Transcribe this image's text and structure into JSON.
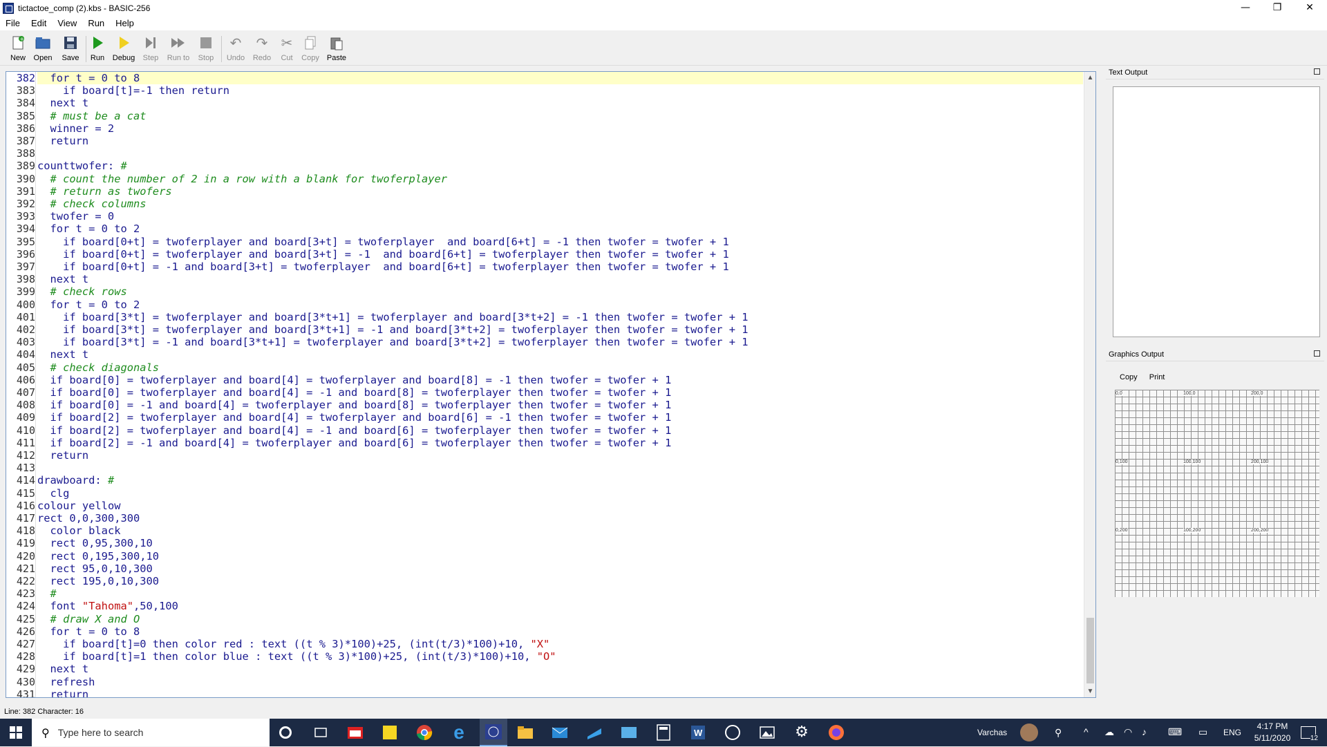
{
  "window": {
    "title": "tictactoe_comp (2).kbs - BASIC-256"
  },
  "menu": [
    "File",
    "Edit",
    "View",
    "Run",
    "Help"
  ],
  "toolbar": [
    {
      "label": "New",
      "icon": "new-file-icon",
      "enabled": true
    },
    {
      "label": "Open",
      "icon": "open-folder-icon",
      "enabled": true
    },
    {
      "label": "Save",
      "icon": "save-disk-icon",
      "enabled": true
    },
    {
      "label": "Run",
      "icon": "run-play-icon",
      "enabled": true
    },
    {
      "label": "Debug",
      "icon": "debug-icon",
      "enabled": true
    },
    {
      "label": "Step",
      "icon": "step-icon",
      "enabled": false
    },
    {
      "label": "Run to",
      "icon": "run-to-icon",
      "enabled": false
    },
    {
      "label": "Stop",
      "icon": "stop-icon",
      "enabled": false
    },
    {
      "label": "Undo",
      "icon": "undo-icon",
      "enabled": false
    },
    {
      "label": "Redo",
      "icon": "redo-icon",
      "enabled": false
    },
    {
      "label": "Cut",
      "icon": "cut-icon",
      "enabled": false
    },
    {
      "label": "Copy",
      "icon": "copy-icon",
      "enabled": false
    },
    {
      "label": "Paste",
      "icon": "paste-icon",
      "enabled": true
    }
  ],
  "editor": {
    "current_line": 382,
    "lines": [
      {
        "n": "382",
        "code": "  for t = 0 to 8"
      },
      {
        "n": "383",
        "code": "    if board[t]=-1 then return"
      },
      {
        "n": "384",
        "code": "  next t"
      },
      {
        "n": "385",
        "code": "  # must be a cat"
      },
      {
        "n": "386",
        "code": "  winner = 2"
      },
      {
        "n": "387",
        "code": "  return"
      },
      {
        "n": "388",
        "code": ""
      },
      {
        "n": "389",
        "code": "counttwofer: #"
      },
      {
        "n": "390",
        "code": "  # count the number of 2 in a row with a blank for twoferplayer"
      },
      {
        "n": "391",
        "code": "  # return as twofers"
      },
      {
        "n": "392",
        "code": "  # check columns"
      },
      {
        "n": "393",
        "code": "  twofer = 0"
      },
      {
        "n": "394",
        "code": "  for t = 0 to 2"
      },
      {
        "n": "395",
        "code": "    if board[0+t] = twoferplayer and board[3+t] = twoferplayer  and board[6+t] = -1 then twofer = twofer + 1"
      },
      {
        "n": "396",
        "code": "    if board[0+t] = twoferplayer and board[3+t] = -1  and board[6+t] = twoferplayer then twofer = twofer + 1"
      },
      {
        "n": "397",
        "code": "    if board[0+t] = -1 and board[3+t] = twoferplayer  and board[6+t] = twoferplayer then twofer = twofer + 1"
      },
      {
        "n": "398",
        "code": "  next t"
      },
      {
        "n": "399",
        "code": "  # check rows"
      },
      {
        "n": "400",
        "code": "  for t = 0 to 2"
      },
      {
        "n": "401",
        "code": "    if board[3*t] = twoferplayer and board[3*t+1] = twoferplayer and board[3*t+2] = -1 then twofer = twofer + 1"
      },
      {
        "n": "402",
        "code": "    if board[3*t] = twoferplayer and board[3*t+1] = -1 and board[3*t+2] = twoferplayer then twofer = twofer + 1"
      },
      {
        "n": "403",
        "code": "    if board[3*t] = -1 and board[3*t+1] = twoferplayer and board[3*t+2] = twoferplayer then twofer = twofer + 1"
      },
      {
        "n": "404",
        "code": "  next t"
      },
      {
        "n": "405",
        "code": "  # check diagonals"
      },
      {
        "n": "406",
        "code": "  if board[0] = twoferplayer and board[4] = twoferplayer and board[8] = -1 then twofer = twofer + 1"
      },
      {
        "n": "407",
        "code": "  if board[0] = twoferplayer and board[4] = -1 and board[8] = twoferplayer then twofer = twofer + 1"
      },
      {
        "n": "408",
        "code": "  if board[0] = -1 and board[4] = twoferplayer and board[8] = twoferplayer then twofer = twofer + 1"
      },
      {
        "n": "409",
        "code": "  if board[2] = twoferplayer and board[4] = twoferplayer and board[6] = -1 then twofer = twofer + 1"
      },
      {
        "n": "410",
        "code": "  if board[2] = twoferplayer and board[4] = -1 and board[6] = twoferplayer then twofer = twofer + 1"
      },
      {
        "n": "411",
        "code": "  if board[2] = -1 and board[4] = twoferplayer and board[6] = twoferplayer then twofer = twofer + 1"
      },
      {
        "n": "412",
        "code": "  return"
      },
      {
        "n": "413",
        "code": ""
      },
      {
        "n": "414",
        "code": "drawboard: #"
      },
      {
        "n": "415",
        "code": "  clg"
      },
      {
        "n": "416",
        "code": "colour yellow"
      },
      {
        "n": "417",
        "code": "rect 0,0,300,300"
      },
      {
        "n": "418",
        "code": "  color black"
      },
      {
        "n": "419",
        "code": "  rect 0,95,300,10"
      },
      {
        "n": "420",
        "code": "  rect 0,195,300,10"
      },
      {
        "n": "421",
        "code": "  rect 95,0,10,300"
      },
      {
        "n": "422",
        "code": "  rect 195,0,10,300"
      },
      {
        "n": "423",
        "code": "  #"
      },
      {
        "n": "424",
        "code": "  font \"Tahoma\",50,100"
      },
      {
        "n": "425",
        "code": "  # draw X and O"
      },
      {
        "n": "426",
        "code": "  for t = 0 to 8"
      },
      {
        "n": "427",
        "code": "    if board[t]=0 then color red : text ((t % 3)*100)+25, (int(t/3)*100)+10, \"X\""
      },
      {
        "n": "428",
        "code": "    if board[t]=1 then color blue : text ((t % 3)*100)+25, (int(t/3)*100)+10, \"O\""
      },
      {
        "n": "429",
        "code": "  next t"
      },
      {
        "n": "430",
        "code": "  refresh"
      },
      {
        "n": "431",
        "code": "  return"
      }
    ]
  },
  "status": {
    "text": "Line: 382 Character: 16"
  },
  "text_output": {
    "title": "Text Output"
  },
  "graphics_output": {
    "title": "Graphics Output",
    "copy_label": "Copy",
    "print_label": "Print",
    "grid_labels": [
      "0,0",
      "100,0",
      "200,0",
      "0,100",
      "100,100",
      "200,100",
      "0,200",
      "100,200",
      "200,200"
    ]
  },
  "taskbar": {
    "search_placeholder": "Type here to search",
    "user": "Varchas",
    "language": "ENG",
    "time": "4:17 PM",
    "date": "5/11/2020",
    "notifications": "12"
  },
  "colors": {
    "keyword": "#1a1a8f",
    "comment": "#1e8c1e",
    "string": "#c01010",
    "current_line": "#ffffc8",
    "taskbar": "#1c2a44"
  }
}
